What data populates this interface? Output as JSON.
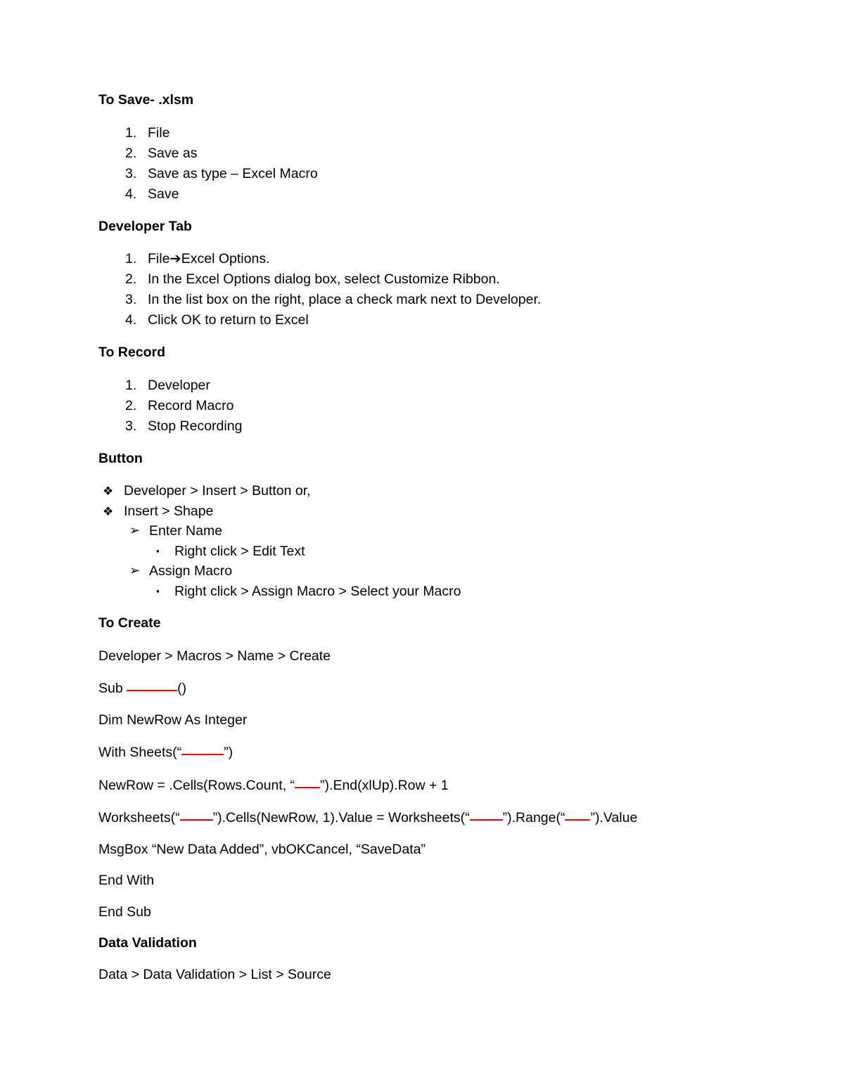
{
  "document": {
    "sections": [
      {
        "id": "to-save",
        "heading": "To Save",
        "heading_suffix": "- .xlsm",
        "type": "ordered",
        "items": [
          "File",
          "Save as",
          "Save as type – Excel Macro",
          "Save"
        ]
      },
      {
        "id": "developer-tab",
        "heading": "Developer Tab",
        "heading_suffix": "",
        "type": "ordered",
        "items": [
          "File➔Excel Options.",
          "In the Excel Options dialog box, select Customize Ribbon.",
          "In the list box on the right, place a check mark next to Developer.",
          "Click OK to return to Excel"
        ]
      },
      {
        "id": "to-record",
        "heading": "To Record",
        "heading_suffix": "",
        "type": "ordered",
        "items": [
          "Developer",
          "Record Macro",
          "Stop Recording"
        ]
      },
      {
        "id": "button",
        "heading": "Button",
        "heading_suffix": "",
        "type": "bulleted",
        "items": [
          {
            "level": 1,
            "bullet": "diamond-cluster-bullet",
            "glyph": "❖",
            "text": "Developer > Insert > Button or,"
          },
          {
            "level": 1,
            "bullet": "diamond-cluster-bullet",
            "glyph": "❖",
            "text": "Insert > Shape"
          },
          {
            "level": 2,
            "bullet": "arrowhead-bullet",
            "glyph": "➢",
            "text": "Enter Name"
          },
          {
            "level": 3,
            "bullet": "square-bullet",
            "glyph": "▪",
            "text": "Right click > Edit Text"
          },
          {
            "level": 2,
            "bullet": "arrowhead-bullet",
            "glyph": "➢",
            "text": "Assign Macro"
          },
          {
            "level": 3,
            "bullet": "square-bullet",
            "glyph": "▪",
            "text": "Right click > Assign Macro > Select your Macro"
          }
        ]
      },
      {
        "id": "to-create",
        "heading": "To Create",
        "heading_suffix": "",
        "type": "code"
      },
      {
        "id": "data-validation",
        "heading": "Data Validation",
        "heading_suffix": "",
        "type": "code"
      }
    ]
  },
  "code_lines": {
    "menu_path": "Developer > Macros > Name > Create",
    "sub_prefix": "Sub ",
    "sub_suffix": "()",
    "dim_line": "Dim NewRow As Integer",
    "with_prefix": "With Sheets(“",
    "with_suffix": "”)",
    "newrow_prefix": "NewRow = .Cells(Rows.Count, “",
    "newrow_suffix": "”).End(xlUp).Row + 1",
    "worksheets_p1": "Worksheets(“",
    "worksheets_p2": "”).Cells(NewRow, 1).Value = Worksheets(“",
    "worksheets_p3": "”).Range(“",
    "worksheets_p4": "”).Value",
    "msgbox": "MsgBox “New Data Added”, vbOKCancel, “SaveData”",
    "end_with": "End With",
    "end_sub": "End Sub",
    "validation_path": "Data > Data Validation > List > Source"
  },
  "colors": {
    "text": "#000000",
    "blank_underline": "#FF0000",
    "background": "#FFFFFF"
  }
}
